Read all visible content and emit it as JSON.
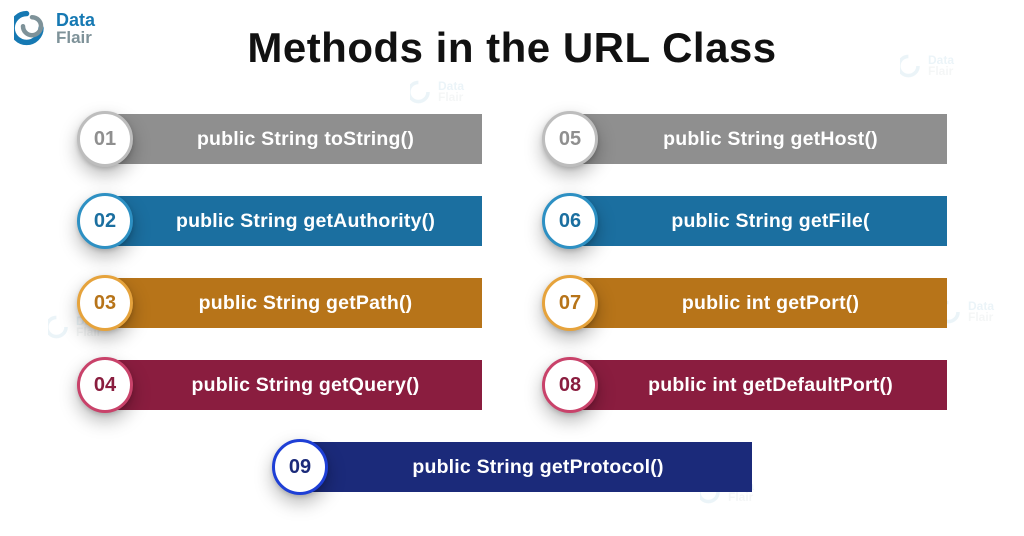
{
  "brand": {
    "word1": "Data",
    "word2": "Flair"
  },
  "title": "Methods in the URL Class",
  "items": [
    {
      "num": "01",
      "label": "public String toString()",
      "color": "grey"
    },
    {
      "num": "02",
      "label": "public String getAuthority()",
      "color": "blue"
    },
    {
      "num": "03",
      "label": "public String getPath()",
      "color": "orange"
    },
    {
      "num": "04",
      "label": "public String getQuery()",
      "color": "maroon"
    },
    {
      "num": "05",
      "label": "public String getHost()",
      "color": "grey"
    },
    {
      "num": "06",
      "label": "public String getFile(",
      "color": "blue"
    },
    {
      "num": "07",
      "label": "public int getPort()",
      "color": "orange"
    },
    {
      "num": "08",
      "label": "public int getDefaultPort()",
      "color": "maroon"
    },
    {
      "num": "09",
      "label": "public String getProtocol()",
      "color": "navy"
    }
  ],
  "chart_data": {
    "type": "table",
    "title": "Methods in the URL Class",
    "rows": [
      {
        "index": 1,
        "method": "public String toString()"
      },
      {
        "index": 2,
        "method": "public String getAuthority()"
      },
      {
        "index": 3,
        "method": "public String getPath()"
      },
      {
        "index": 4,
        "method": "public String getQuery()"
      },
      {
        "index": 5,
        "method": "public String getHost()"
      },
      {
        "index": 6,
        "method": "public String getFile("
      },
      {
        "index": 7,
        "method": "public int getPort()"
      },
      {
        "index": 8,
        "method": "public int getDefaultPort()"
      },
      {
        "index": 9,
        "method": "public String getProtocol()"
      }
    ]
  }
}
